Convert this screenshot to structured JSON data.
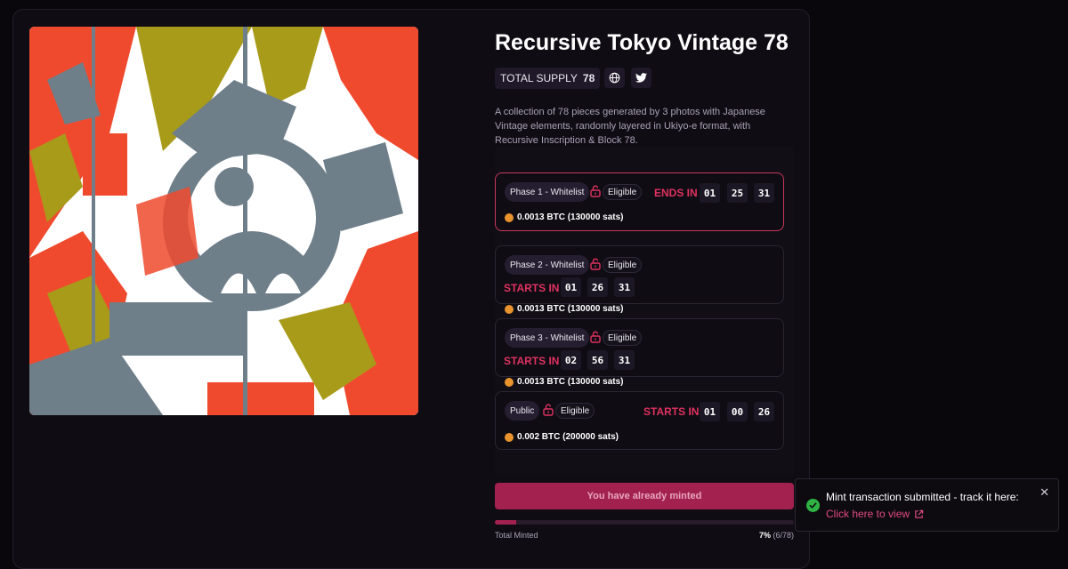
{
  "collection": {
    "title": "Recursive Tokyo Vintage 78",
    "supply_label": "TOTAL SUPPLY",
    "supply_value": "78",
    "description": "A collection of 78 pieces generated by 3 photos with Japanese Vintage elements, randomly layered in Ukiyo-e format, with Recursive Inscription & Block 78."
  },
  "icons": {
    "website": "globe-icon",
    "twitter": "twitter-icon",
    "lock": "unlock-icon",
    "coin": "bitcoin-coin-icon",
    "success": "check-circle-icon",
    "close": "close-icon",
    "external": "external-link-icon"
  },
  "phases": [
    {
      "name": "Phase 1 - Whitelist",
      "eligibility": "Eligible",
      "timer_label": "ENDS IN",
      "timer": [
        "01",
        "25",
        "31"
      ],
      "price": "0.0013 BTC (130000 sats)",
      "active": true
    },
    {
      "name": "Phase 2 - Whitelist",
      "eligibility": "Eligible",
      "timer_label": "STARTS IN",
      "timer": [
        "01",
        "26",
        "31"
      ],
      "price": "0.0013 BTC (130000 sats)",
      "active": false
    },
    {
      "name": "Phase 3 - Whitelist",
      "eligibility": "Eligible",
      "timer_label": "STARTS IN",
      "timer": [
        "02",
        "56",
        "31"
      ],
      "price": "0.0013 BTC (130000 sats)",
      "active": false
    },
    {
      "name": "Public",
      "eligibility": "Eligible",
      "timer_label": "STARTS IN",
      "timer": [
        "01",
        "00",
        "26"
      ],
      "price": "0.002 BTC (200000 sats)",
      "active": false
    }
  ],
  "mint": {
    "button_label": "You have already minted",
    "progress_fraction": 0.07,
    "total_label": "Total Minted",
    "percent": "7%",
    "count": "(6/78)"
  },
  "toast": {
    "message": "Mint transaction submitted - track it here:",
    "link_label": "Click here to view",
    "close_glyph": "✕"
  },
  "colors": {
    "accent": "#e0325f",
    "button": "#a3214f",
    "success": "#2fb344",
    "link": "#e24a80"
  }
}
